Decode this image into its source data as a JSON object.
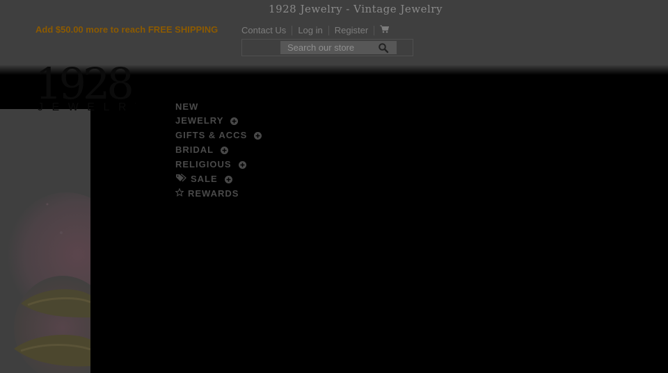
{
  "header": {
    "site_title": "1928 Jewelry - Vintage Jewelry",
    "promo_prefix": "Add ",
    "promo_amount": "$50.00",
    "promo_mid": " more to reach ",
    "promo_highlight": "FREE SHIPPING",
    "links": [
      "Contact Us",
      "Log in",
      "Register"
    ],
    "search_placeholder": "Search our store"
  },
  "logo": {
    "numerals": "1928",
    "word": "JEWELRY"
  },
  "nav": {
    "new_line1": "NEW",
    "new_line2": "JEWELRY",
    "gifts": "GIFTS & ACCS",
    "bridal": "BRIDAL",
    "religious": "RELIGIOUS",
    "sale": "SALE",
    "rewards": "REWARDS"
  },
  "icons": {
    "cart": "cart-icon",
    "search": "search-icon",
    "expand": "plus-circle-icon",
    "sale": "tags-icon",
    "rewards": "star-icon"
  },
  "colors": {
    "overlay": "#000000",
    "promo": "#8c5a00",
    "header_bg": "#3f3f3f"
  }
}
